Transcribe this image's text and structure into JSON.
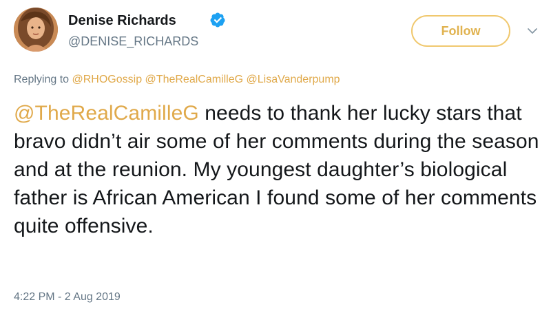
{
  "author": {
    "name": "Denise Richards",
    "handle": "@DENISE_RICHARDS",
    "verified": true,
    "avatar_icon": "profile-photo"
  },
  "follow_button": {
    "label": "Follow",
    "accent_color": "#e0b24e"
  },
  "menu_icon": "chevron-down-icon",
  "reply": {
    "prefix": "Replying to",
    "mentions": [
      "@RHOGossip",
      "@TheRealCamilleG",
      "@LisaVanderpump"
    ]
  },
  "tweet": {
    "mention": "@TheRealCamilleG",
    "text": " needs to thank her lucky stars that bravo didn’t air some of her comments during the season and at the reunion. My youngest daughter’s biological father is African American I found some of her comments quite offensive."
  },
  "timestamp": "4:22 PM - 2 Aug 2019",
  "colors": {
    "link": "#e0a94a",
    "secondary_text": "#657786",
    "primary_text": "#14171a",
    "verified": "#1da1f2"
  }
}
